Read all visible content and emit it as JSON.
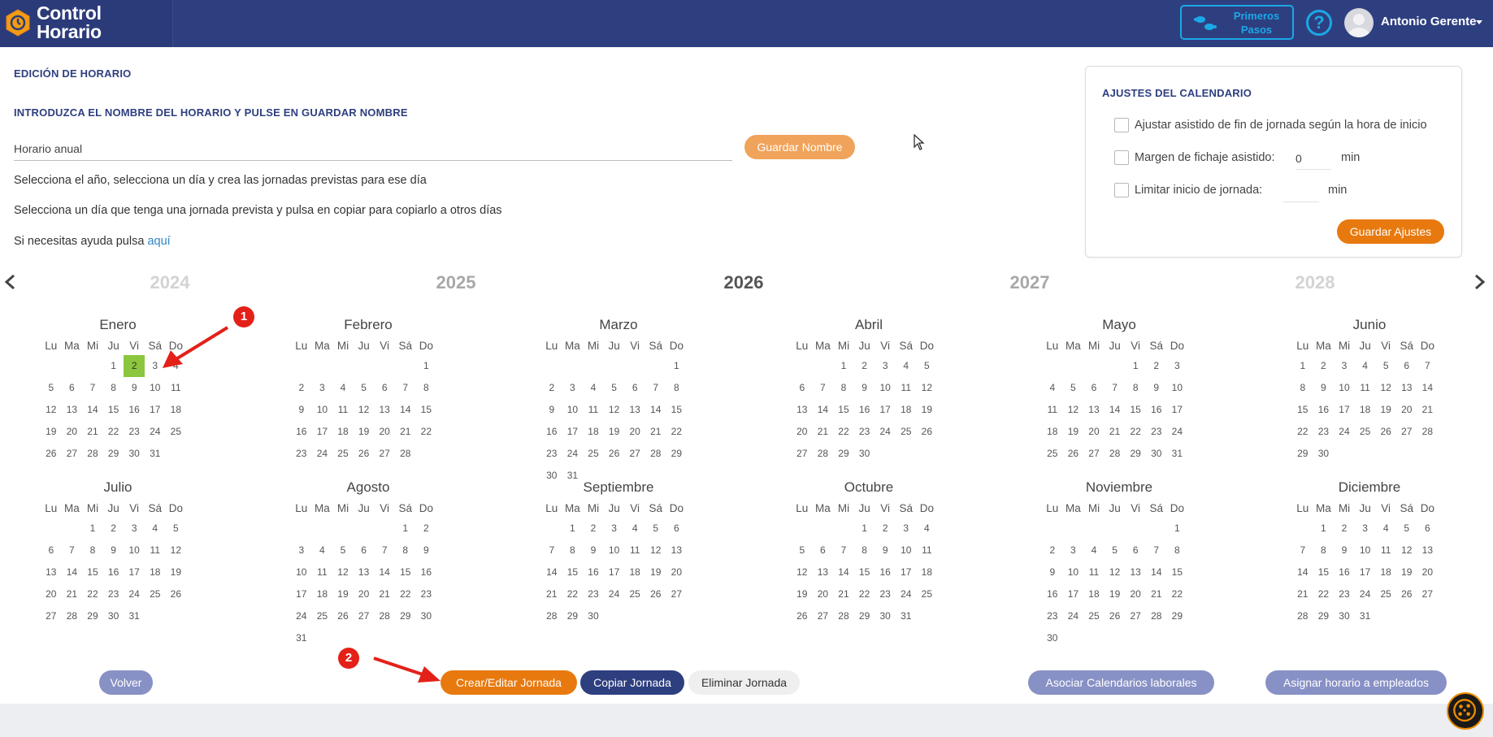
{
  "header": {
    "brand_line1": "Control",
    "brand_line2": "Horario",
    "first_steps_line1": "Primeros",
    "first_steps_line2": "Pasos",
    "help_symbol": "?",
    "user_name": "Antonio Gerente"
  },
  "editor": {
    "section_title": "EDICIÓN DE HORARIO",
    "name_prompt": "INTRODUZCA EL NOMBRE DEL HORARIO Y PULSE EN GUARDAR NOMBRE",
    "name_value": "Horario anual",
    "save_name_label": "Guardar Nombre",
    "instruction_1": "Selecciona el año, selecciona un día y crea las jornadas previstas para ese día",
    "instruction_2": "Selecciona un día que tenga una jornada prevista y pulsa en copiar para copiarlo a otros días",
    "help_prefix": "Si necesitas ayuda pulsa ",
    "help_link": "aquí"
  },
  "settings": {
    "title": "AJUSTES DEL CALENDARIO",
    "opt1_label": "Ajustar asistido de fin de jornada según la hora de inicio",
    "opt2_label": "Margen de fichaje asistido:",
    "opt2_value": "0",
    "opt2_unit": "min",
    "opt3_label": "Limitar inicio de jornada:",
    "opt3_value": "",
    "opt3_unit": "min",
    "save_label": "Guardar Ajustes"
  },
  "years": [
    "2024",
    "2025",
    "2026",
    "2027",
    "2028"
  ],
  "current_year": "2026",
  "weekday_labels": [
    "Lu",
    "Ma",
    "Mi",
    "Ju",
    "Vi",
    "Sá",
    "Do"
  ],
  "months": [
    {
      "name": "Enero",
      "offset": 3,
      "days": 31
    },
    {
      "name": "Febrero",
      "offset": 6,
      "days": 28
    },
    {
      "name": "Marzo",
      "offset": 6,
      "days": 31
    },
    {
      "name": "Abril",
      "offset": 2,
      "days": 30
    },
    {
      "name": "Mayo",
      "offset": 4,
      "days": 31
    },
    {
      "name": "Junio",
      "offset": 0,
      "days": 30
    },
    {
      "name": "Julio",
      "offset": 2,
      "days": 31
    },
    {
      "name": "Agosto",
      "offset": 5,
      "days": 31
    },
    {
      "name": "Septiembre",
      "offset": 1,
      "days": 30
    },
    {
      "name": "Octubre",
      "offset": 3,
      "days": 31
    },
    {
      "name": "Noviembre",
      "offset": 6,
      "days": 30
    },
    {
      "name": "Diciembre",
      "offset": 1,
      "days": 31
    }
  ],
  "selected_day": {
    "month": "Enero",
    "day": 2
  },
  "actions": {
    "back": "Volver",
    "create_edit": "Crear/Editar Jornada",
    "copy": "Copiar Jornada",
    "delete": "Eliminar Jornada",
    "associate": "Asociar Calendarios laborales",
    "assign": "Asignar horario a empleados"
  },
  "annotations": [
    "1",
    "2"
  ],
  "colors": {
    "header_bg": "#2e3f80",
    "accent_orange": "#e8790e",
    "selected_day": "#8cc63e",
    "annotation_red": "#e32119"
  }
}
